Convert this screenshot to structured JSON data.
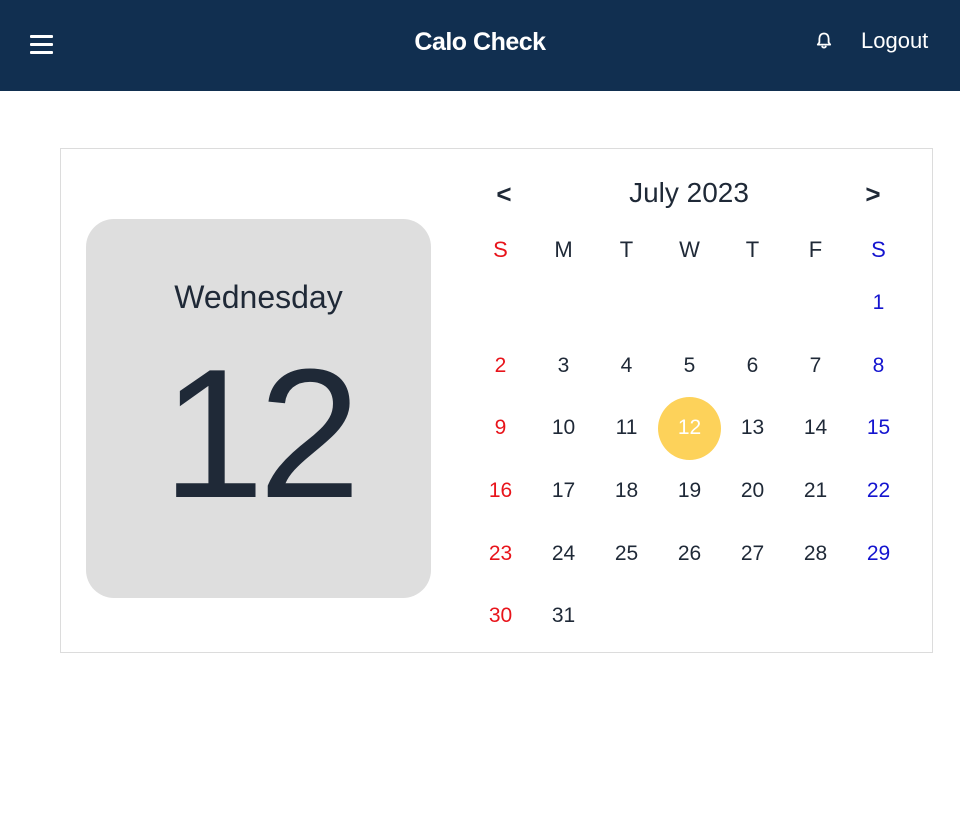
{
  "header": {
    "brand": "Calo Check",
    "logout_label": "Logout",
    "menu_icon": "hamburger-menu-icon",
    "bell_icon": "bell-icon"
  },
  "selected_day": {
    "weekday": "Wednesday",
    "day": "12"
  },
  "calendar": {
    "prev_label": "<",
    "next_label": ">",
    "month_title": "July 2023",
    "weekday_headers": [
      "S",
      "M",
      "T",
      "W",
      "T",
      "F",
      "S"
    ],
    "leading_blanks": 6,
    "days": [
      "1",
      "2",
      "3",
      "4",
      "5",
      "6",
      "7",
      "8",
      "9",
      "10",
      "11",
      "12",
      "13",
      "14",
      "15",
      "16",
      "17",
      "18",
      "19",
      "20",
      "21",
      "22",
      "23",
      "24",
      "25",
      "26",
      "27",
      "28",
      "29",
      "30",
      "31"
    ],
    "selected": "12"
  },
  "colors": {
    "topbar": "#112f50",
    "sunday": "#e8141b",
    "saturday": "#1414cf",
    "selected_highlight": "#fdd25a",
    "daybox": "#dedede"
  }
}
